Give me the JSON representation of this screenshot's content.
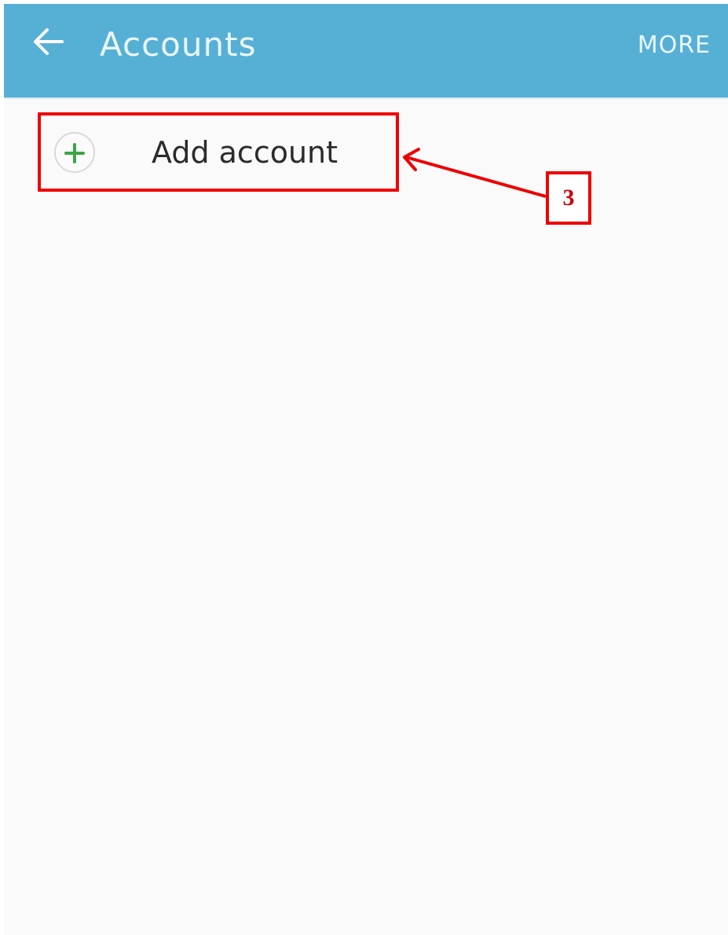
{
  "app_bar": {
    "title": "Accounts",
    "more_label": "MORE",
    "background_color": "#56b0d6"
  },
  "accounts_list": {
    "add_account": {
      "label": "Add account",
      "icon": "plus-icon",
      "icon_color": "#3aa648"
    }
  },
  "annotation": {
    "step_number": "3",
    "color": "#ee0000"
  }
}
